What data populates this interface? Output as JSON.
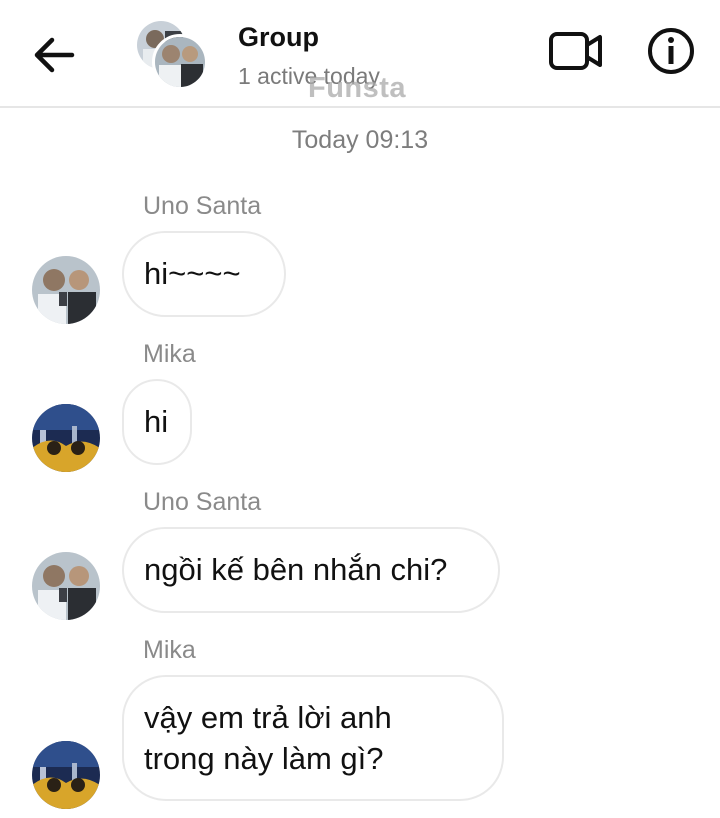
{
  "header": {
    "title": "Group",
    "subtitle": "1 active today",
    "watermark": "Funsta",
    "icons": [
      "arrow-left-icon",
      "video-camera-icon",
      "info-icon"
    ]
  },
  "conversation": {
    "timestamp": "Today 09:13",
    "messages": [
      {
        "sender": "Uno Santa",
        "text": "hi~~~~"
      },
      {
        "sender": "Mika",
        "text": "hi"
      },
      {
        "sender": "Uno Santa",
        "text": "ngồi kế bên nhắn chi?"
      },
      {
        "sender": "Mika",
        "text_lines": [
          "vậy em trả lời anh",
          "trong này làm gì?"
        ]
      }
    ]
  },
  "colors": {
    "text": "#111111",
    "secondary_text": "#7d7d7d",
    "bubble_border": "#e9e9e9",
    "divider": "#e6e6e6"
  }
}
